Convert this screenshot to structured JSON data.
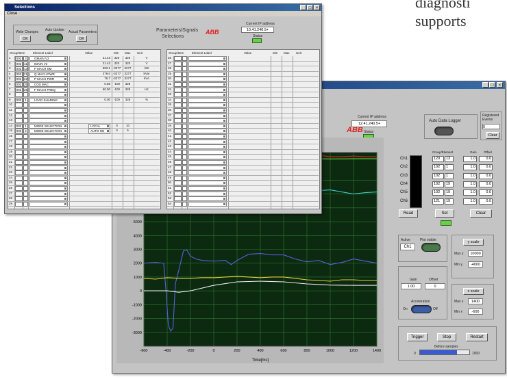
{
  "background_text": {
    "line1": "diagnosti",
    "line2": "supports"
  },
  "win1": {
    "title": "Selections",
    "menu": "Close",
    "write_changes": {
      "label": "Write Changes",
      "btn": "OK"
    },
    "auto_update": {
      "label": "Auto Update"
    },
    "actual_params": {
      "label": "Actual Parameters",
      "btn": "OK"
    },
    "heading_line1": "Parameters/Signals",
    "heading_line2": "Selections",
    "logo": "ABB",
    "ip": {
      "label": "Current IP address",
      "value": "10.41.240.5+",
      "status_label": "Status"
    },
    "left_table": {
      "headers": {
        "group": "Group/Item",
        "label": "Element Label",
        "value": "Value",
        "min": "Min",
        "max": "Max",
        "unit": "Unit"
      },
      "rows": [
        {
          "n": "1",
          "g": "002",
          "i": "3",
          "lab": "GMAIN V2",
          "val": "21.43",
          "mn": "320",
          "mx": "320",
          "u": "V"
        },
        {
          "n": "2",
          "g": "002",
          "i": "11",
          "lab": "IMAIN V2",
          "val": "21.43",
          "mn": "320",
          "mx": "320",
          "u": "V"
        },
        {
          "n": "3",
          "g": "002",
          "i": "13",
          "lab": "P MACH SM",
          "val": "693.1",
          "mn": "-3277",
          "mx": "3277",
          "u": "kW"
        },
        {
          "n": "4",
          "g": "002",
          "i": "21",
          "lab": "Q MACH PWR",
          "val": "379.0",
          "mn": "-3277",
          "mx": "3277",
          "u": "kVar"
        },
        {
          "n": "5",
          "g": "002",
          "i": "22",
          "lab": "P MACH PWR",
          "val": "76.7",
          "mn": "-3277",
          "mx": "3277",
          "u": "kVA"
        },
        {
          "n": "6",
          "g": "002",
          "i": "25",
          "lab": "COS MAC",
          "val": "0.88",
          "mn": "-100",
          "mx": "328",
          "u": ""
        },
        {
          "n": "7",
          "g": "002",
          "i": "26",
          "lab": "F MACH FREQ",
          "val": "50.00",
          "mn": "-100",
          "mx": "328",
          "u": "Hz"
        },
        {
          "n": "8",
          "g": "",
          "i": "",
          "lab": "",
          "val": "",
          "mn": "",
          "mx": "",
          "u": ""
        },
        {
          "n": "9",
          "g": "003",
          "i": "1",
          "lab": "LOAD SHARING",
          "val": "0.00",
          "mn": "-100",
          "mx": "328",
          "u": "%"
        },
        {
          "n": "10",
          "g": "",
          "i": "",
          "lab": "",
          "val": "",
          "mn": "",
          "mx": "",
          "u": ""
        },
        {
          "n": "11",
          "g": "",
          "i": "",
          "lab": "",
          "val": "",
          "mn": "",
          "mx": "",
          "u": ""
        },
        {
          "n": "12",
          "g": "",
          "i": "",
          "lab": "",
          "val": "",
          "mn": "",
          "mx": "",
          "u": ""
        },
        {
          "n": "13",
          "g": "",
          "i": "",
          "lab": "",
          "val": "",
          "mn": "",
          "mx": "",
          "u": ""
        },
        {
          "n": "14",
          "g": "002",
          "i": "1",
          "lab": "MODE SELECTION",
          "val": "LOCAL",
          "mn": "0",
          "mx": "10",
          "u": ""
        },
        {
          "n": "15",
          "g": "003",
          "i": "2",
          "lab": "MODE SELECTION",
          "val": "AUTO ON",
          "mn": "0",
          "mx": "5",
          "u": ""
        },
        {
          "n": "16",
          "g": "",
          "i": "",
          "lab": "",
          "val": "",
          "mn": "",
          "mx": "",
          "u": ""
        },
        {
          "n": "17",
          "g": "",
          "i": "",
          "lab": "",
          "val": "",
          "mn": "",
          "mx": "",
          "u": ""
        },
        {
          "n": "18",
          "g": "",
          "i": "",
          "lab": "",
          "val": "",
          "mn": "",
          "mx": "",
          "u": ""
        },
        {
          "n": "19",
          "g": "",
          "i": "",
          "lab": "",
          "val": "",
          "mn": "",
          "mx": "",
          "u": ""
        },
        {
          "n": "20",
          "g": "",
          "i": "",
          "lab": "",
          "val": "",
          "mn": "",
          "mx": "",
          "u": ""
        },
        {
          "n": "21",
          "g": "",
          "i": "",
          "lab": "",
          "val": "",
          "mn": "",
          "mx": "",
          "u": ""
        },
        {
          "n": "22",
          "g": "",
          "i": "",
          "lab": "",
          "val": "",
          "mn": "",
          "mx": "",
          "u": ""
        },
        {
          "n": "23",
          "g": "",
          "i": "",
          "lab": "",
          "val": "",
          "mn": "",
          "mx": "",
          "u": ""
        },
        {
          "n": "24",
          "g": "",
          "i": "",
          "lab": "",
          "val": "",
          "mn": "",
          "mx": "",
          "u": ""
        },
        {
          "n": "25",
          "g": "",
          "i": "",
          "lab": "",
          "val": "",
          "mn": "",
          "mx": "",
          "u": ""
        },
        {
          "n": "26",
          "g": "",
          "i": "",
          "lab": "",
          "val": "",
          "mn": "",
          "mx": "",
          "u": ""
        },
        {
          "n": "27",
          "g": "",
          "i": "",
          "lab": "",
          "val": "",
          "mn": "",
          "mx": "",
          "u": ""
        },
        {
          "n": "28",
          "g": "",
          "i": "",
          "lab": "",
          "val": "",
          "mn": "",
          "mx": "",
          "u": ""
        },
        {
          "n": "29",
          "g": "",
          "i": "",
          "lab": "",
          "val": "",
          "mn": "",
          "mx": "",
          "u": ""
        }
      ]
    },
    "right_table": {
      "headers": {
        "group": "Group/Item",
        "label": "Element Label",
        "value": "Value",
        "min": "Min",
        "max": "Max",
        "unit": "Unit"
      },
      "start": 26,
      "count": 29
    }
  },
  "win2": {
    "logo": "ABB",
    "ip": {
      "label": "Current IP address",
      "value": "12.41.240.5+",
      "status_label": "Status"
    },
    "datalogger": {
      "label": "Auto Data Logger"
    },
    "registered": {
      "label": "Registered Events",
      "value": "0",
      "clear": "Clear"
    },
    "channels": {
      "labels": [
        "Ch1",
        "Ch2",
        "Ch3",
        "Ch4",
        "Ch5",
        "Ch6"
      ],
      "head_group": "Group/Element",
      "head_gain": "Gain",
      "head_offset": "Offset",
      "groups": [
        "120",
        "102",
        "102",
        "102",
        "102",
        "121"
      ],
      "elements": [
        "13",
        "1",
        "1",
        "19",
        "19",
        "19"
      ],
      "gains": [
        "1.0",
        "1.0",
        "1.0",
        "1.0",
        "1.0",
        "1.0"
      ],
      "offsets": [
        "0.0",
        "0.0",
        "0.0",
        "0.0",
        "0.0",
        "0.0"
      ]
    },
    "buttons": {
      "read": "Read",
      "set": "Set",
      "clear": "Clear",
      "trigger": "Trigger",
      "stop": "Stop",
      "restart": "Restart",
      "y_scale": "y scale",
      "x_scale": "x scale"
    },
    "active": {
      "label": "Active",
      "value": "Ch1",
      "plot_visible": "Plot visible"
    },
    "y_range": {
      "max_label": "Max y",
      "max_value": "10000",
      "min_label": "Min y",
      "min_value": "-4000"
    },
    "x_range": {
      "max_label": "Max x",
      "max_value": "1400",
      "min_label": "Min x",
      "min_value": "-600"
    },
    "gain_offset": {
      "gain_label": "Gain",
      "gain_value": "1.00",
      "offset_label": "Offset",
      "offset_value": "0"
    },
    "acceleration": {
      "label": "Acceleration",
      "on": "On",
      "off": "Off"
    },
    "before_samples": {
      "label": "Before samples",
      "min": "0",
      "max": "1000",
      "level": 0.75
    },
    "colors": {
      "plot_bg": "#0c2a10",
      "grid": "#2f7a2f",
      "ch_red": "#e02020",
      "ch_teal": "#40c8c8",
      "ch_blue": "#5860e0",
      "ch_yellow": "#e8d040",
      "ch_white": "#f0f0f0",
      "ch_green": "#60d040"
    }
  },
  "chart_data": {
    "type": "line",
    "xlabel": "Time[ms]",
    "ylabel": "",
    "xlim": [
      -600,
      1400
    ],
    "ylim": [
      -4000,
      10000
    ],
    "x_ticks": [
      -600,
      -400,
      -200,
      0,
      200,
      400,
      600,
      800,
      1000,
      1200,
      1400
    ],
    "y_ticks": [
      -3000,
      -2000,
      -1000,
      0,
      1000,
      2000,
      3000,
      4000,
      5000,
      6000,
      7000,
      8000
    ],
    "series": [
      {
        "color": "red",
        "x": [
          -330,
          -300,
          -250,
          -200,
          -150,
          -100,
          -50,
          0,
          50,
          100,
          150,
          200,
          300,
          400,
          500,
          600,
          700,
          800,
          900,
          1000,
          1100,
          1200,
          1300,
          1400
        ],
        "y": [
          9950,
          9600,
          9800,
          9950,
          9900,
          9900,
          9950,
          9900,
          9900,
          9900,
          9900,
          9900,
          9900,
          9900,
          9850,
          9800,
          9850,
          9700,
          9800,
          9700,
          9700,
          9750,
          9700,
          9700
        ]
      },
      {
        "color": "green",
        "x": [
          -600,
          -400,
          -200,
          0,
          200,
          400,
          600,
          800,
          1000,
          1200,
          1400
        ],
        "y": [
          9550,
          9580,
          9550,
          9570,
          9540,
          9560,
          9550,
          9560,
          9540,
          9550,
          9550
        ]
      },
      {
        "color": "teal",
        "x": [
          -600,
          -500,
          -400,
          -300,
          -250,
          -200,
          -150,
          -100,
          0,
          100,
          200,
          300,
          400,
          500,
          600,
          700,
          800,
          900,
          1000,
          1100,
          1200,
          1300,
          1400
        ],
        "y": [
          7150,
          7050,
          7000,
          6900,
          6450,
          6500,
          6900,
          7150,
          7250,
          7250,
          7150,
          6950,
          6800,
          6800,
          7000,
          7150,
          7150,
          7250,
          7300,
          7150,
          7000,
          7100,
          7150
        ]
      },
      {
        "color": "blue",
        "x": [
          -600,
          -500,
          -430,
          -410,
          -390,
          -370,
          -350,
          -330,
          -300,
          -260,
          -230,
          -200,
          -150,
          -100,
          0,
          100,
          150,
          200,
          300,
          400,
          500,
          600,
          700,
          800,
          900,
          1000,
          1100,
          1200,
          1300,
          1400
        ],
        "y": [
          2000,
          2050,
          2000,
          0,
          -2500,
          -2900,
          -2700,
          500,
          1500,
          2900,
          2950,
          2500,
          2300,
          2200,
          2150,
          2200,
          1900,
          2200,
          2650,
          2700,
          2600,
          2600,
          2300,
          2100,
          2200,
          1900,
          2050,
          2300,
          2150,
          2000
        ]
      },
      {
        "color": "yellow",
        "x": [
          -600,
          -500,
          -400,
          -300,
          -200,
          -100,
          0,
          100,
          200,
          300,
          400,
          500,
          600,
          700,
          800,
          900,
          1000,
          1100,
          1200,
          1300,
          1400
        ],
        "y": [
          900,
          850,
          950,
          900,
          900,
          950,
          950,
          1000,
          1050,
          1000,
          950,
          1000,
          1000,
          900,
          800,
          750,
          700,
          800,
          800,
          750,
          750
        ]
      },
      {
        "color": "white",
        "x": [
          -600,
          -400,
          -300,
          -200,
          0,
          200,
          400,
          600,
          800,
          1000,
          1200,
          1400
        ],
        "y": [
          0,
          0,
          -100,
          0,
          400,
          650,
          700,
          650,
          500,
          420,
          400,
          400
        ]
      }
    ]
  }
}
